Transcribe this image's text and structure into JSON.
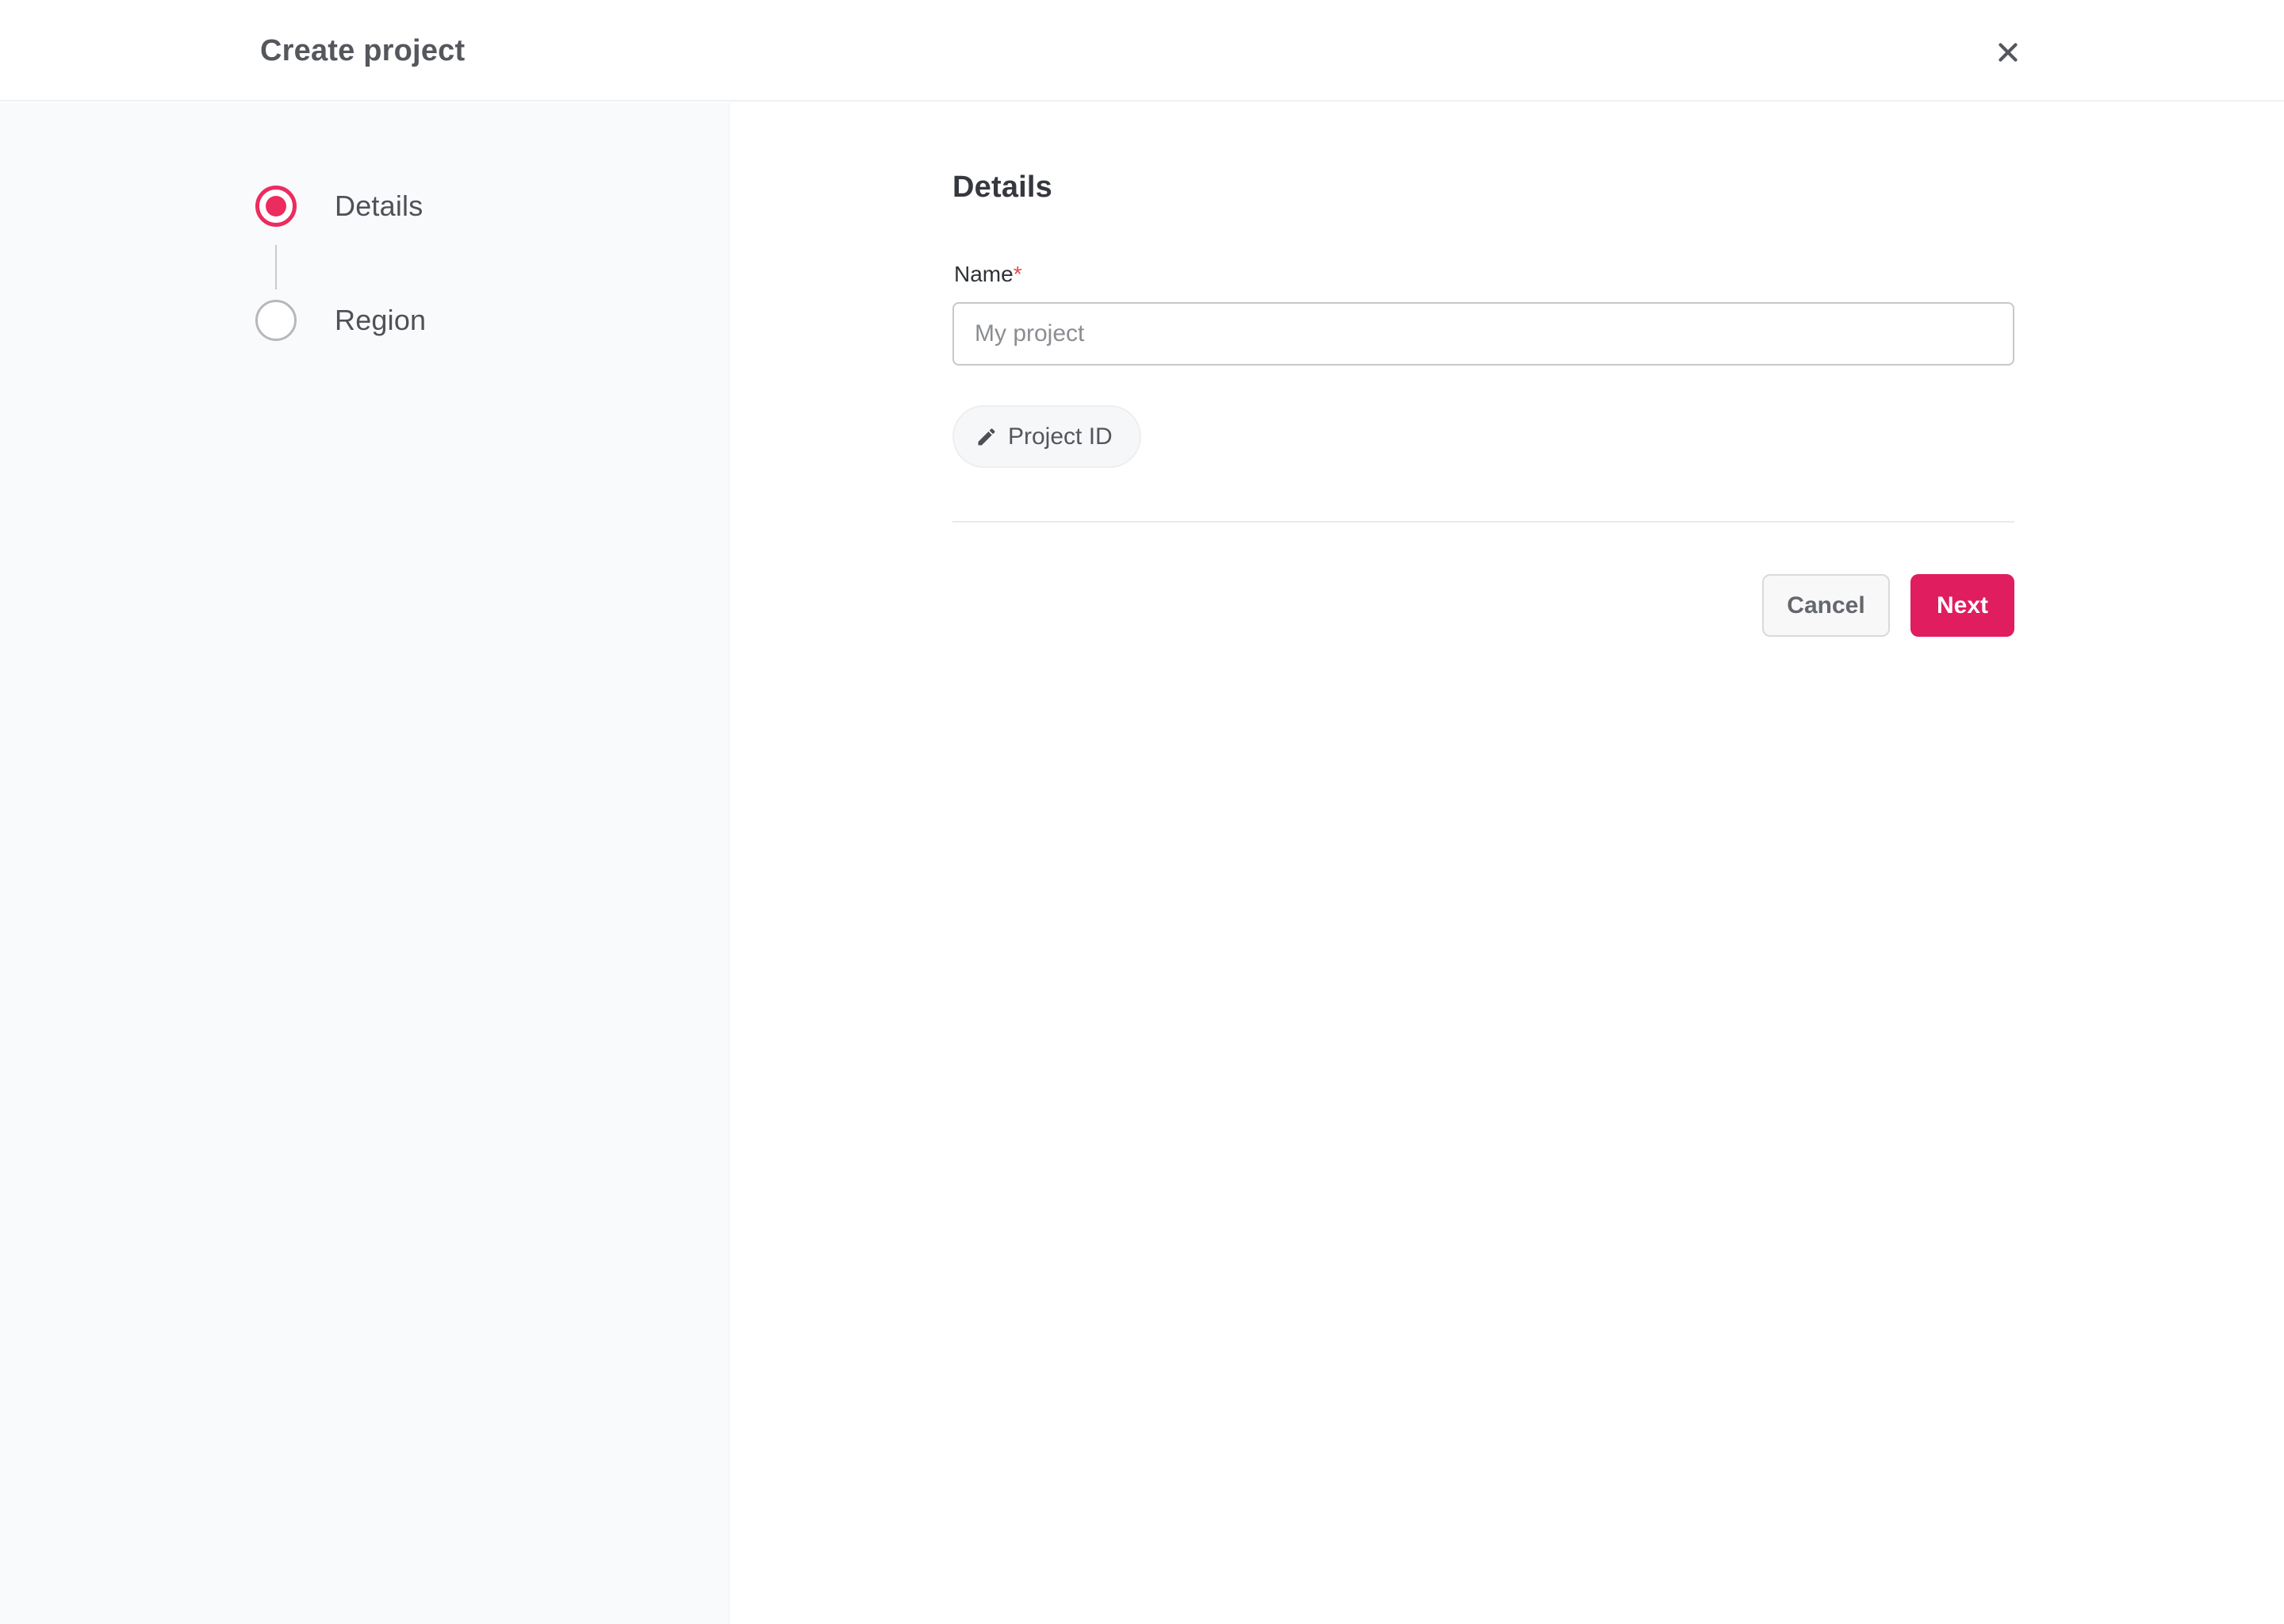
{
  "header": {
    "title": "Create project"
  },
  "stepper": {
    "steps": [
      {
        "label": "Details",
        "state": "active"
      },
      {
        "label": "Region",
        "state": "inactive"
      }
    ]
  },
  "form": {
    "heading": "Details",
    "name_label": "Name",
    "required_marker": "*",
    "name_input": {
      "value": "",
      "placeholder": "My project"
    },
    "project_id_button": {
      "label": "Project ID"
    }
  },
  "footer": {
    "cancel_label": "Cancel",
    "next_label": "Next"
  },
  "icons": {
    "close": "close-icon",
    "edit": "pencil-edit-icon"
  },
  "colors": {
    "accent_pink": "#df1d5f",
    "radio_active_pink": "#ec2c5e",
    "required_red": "#e5484d",
    "sidebar_bg": "#f9fafb"
  }
}
